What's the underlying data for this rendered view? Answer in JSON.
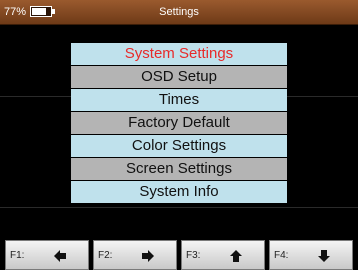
{
  "status_bar": {
    "battery_percent_text": "77%",
    "battery_level": 0.77,
    "title": "Settings"
  },
  "menu": {
    "items": [
      {
        "label": "System Settings",
        "selected": true
      },
      {
        "label": "OSD Setup",
        "selected": false
      },
      {
        "label": "Times",
        "selected": false
      },
      {
        "label": "Factory Default",
        "selected": false
      },
      {
        "label": "Color Settings",
        "selected": false
      },
      {
        "label": "Screen Settings",
        "selected": false
      },
      {
        "label": "System Info",
        "selected": false
      }
    ],
    "selected_color": "#e82a2a"
  },
  "function_keys": [
    {
      "label": "F1:",
      "icon": "arrow-left-icon"
    },
    {
      "label": "F2:",
      "icon": "arrow-right-icon"
    },
    {
      "label": "F3:",
      "icon": "arrow-up-icon"
    },
    {
      "label": "F4:",
      "icon": "arrow-down-icon"
    }
  ],
  "colors": {
    "title_bar": "#7a4219",
    "menu_light": "#bfe1ec",
    "menu_gray": "#b4b4b4",
    "background": "#000000"
  }
}
